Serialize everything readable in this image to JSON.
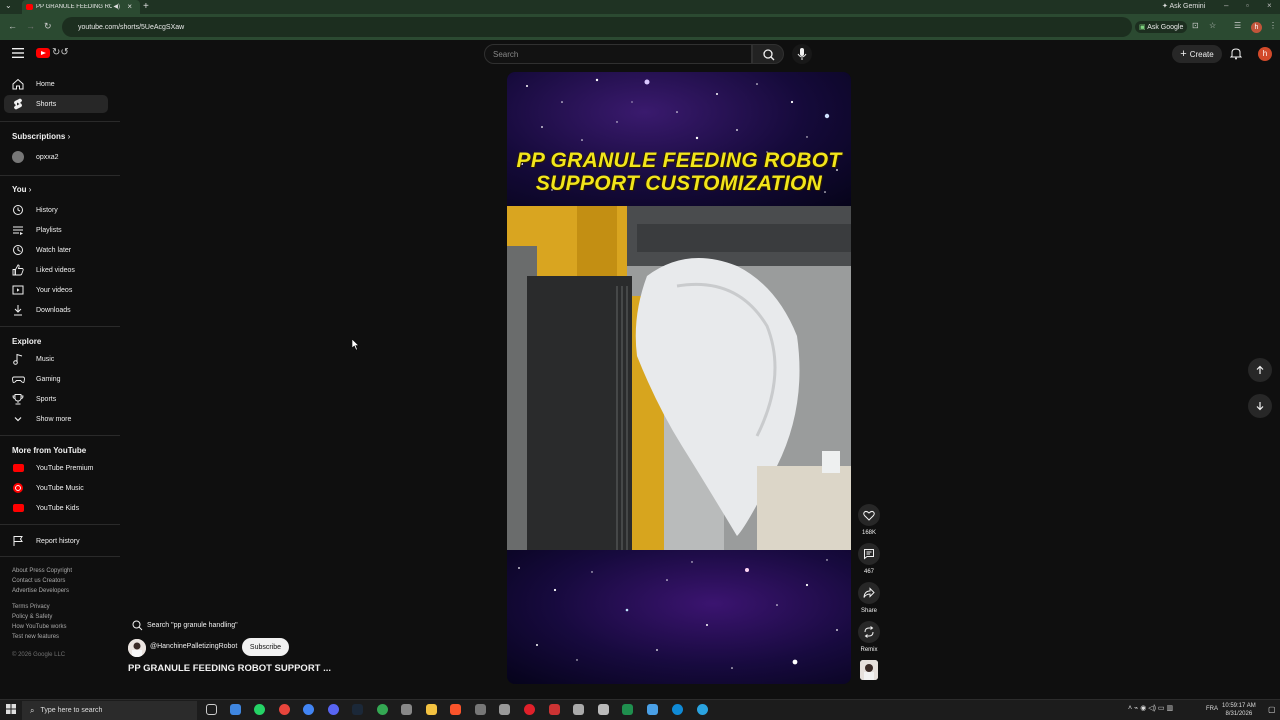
{
  "browser": {
    "tab_title": "PP GRANULE FEEDING RO",
    "url": "youtube.com/shorts/5UeAcgSXaw",
    "ask_gemini": "Ask Gemini",
    "ask_google": "Ask Google",
    "profile_letter": "h"
  },
  "header": {
    "search_placeholder": "Search",
    "create_label": "Create",
    "avatar_letter": "h"
  },
  "sidebar": {
    "main": [
      {
        "label": "Home",
        "icon": "home-icon"
      },
      {
        "label": "Shorts",
        "icon": "shorts-icon",
        "active": true
      }
    ],
    "subscriptions_title": "Subscriptions",
    "subscriptions": [
      {
        "label": "opxxa2"
      }
    ],
    "you_title": "You",
    "you": [
      {
        "label": "History",
        "icon": "history-icon"
      },
      {
        "label": "Playlists",
        "icon": "playlists-icon"
      },
      {
        "label": "Watch later",
        "icon": "clock-icon"
      },
      {
        "label": "Liked videos",
        "icon": "thumbs-up-icon"
      },
      {
        "label": "Your videos",
        "icon": "video-icon"
      },
      {
        "label": "Downloads",
        "icon": "download-icon"
      }
    ],
    "explore_title": "Explore",
    "explore": [
      {
        "label": "Music",
        "icon": "music-note-icon"
      },
      {
        "label": "Gaming",
        "icon": "gamepad-icon"
      },
      {
        "label": "Sports",
        "icon": "trophy-icon"
      },
      {
        "label": "Show more",
        "icon": "chevron-down-icon"
      }
    ],
    "more_title": "More from YouTube",
    "more": [
      {
        "label": "YouTube Premium"
      },
      {
        "label": "YouTube Music"
      },
      {
        "label": "YouTube Kids"
      }
    ],
    "report_history": "Report history",
    "footer": {
      "line1": "About  Press  Copyright",
      "line2": "Contact us  Creators",
      "line3": "Advertise  Developers",
      "line4": "Terms  Privacy",
      "line5": "Policy & Safety",
      "line6": "How YouTube works",
      "line7": "Test new features",
      "copyright": "© 2026 Google LLC"
    }
  },
  "short": {
    "overlay_line1": "PP GRANULE FEEDING ROBOT",
    "overlay_line2": "SUPPORT CUSTOMIZATION",
    "search_chip": "Search \"pp granule handling\"",
    "channel": "@HanchinePalletizingRobot",
    "subscribe_label": "Subscribe",
    "title": "PP GRANULE FEEDING ROBOT SUPPORT ...",
    "likes": "168K",
    "comments": "467",
    "share_label": "Share",
    "remix_label": "Remix"
  },
  "taskbar": {
    "search_placeholder": "Type here to search",
    "lang": "FRA",
    "time": "10:59:17 AM",
    "date": "8/31/2026"
  },
  "colors": {
    "background": "#0f0f0f",
    "brand_red": "#ff0000",
    "overlay_yellow": "#f2e51b",
    "browser_green": "#2b4a31"
  }
}
